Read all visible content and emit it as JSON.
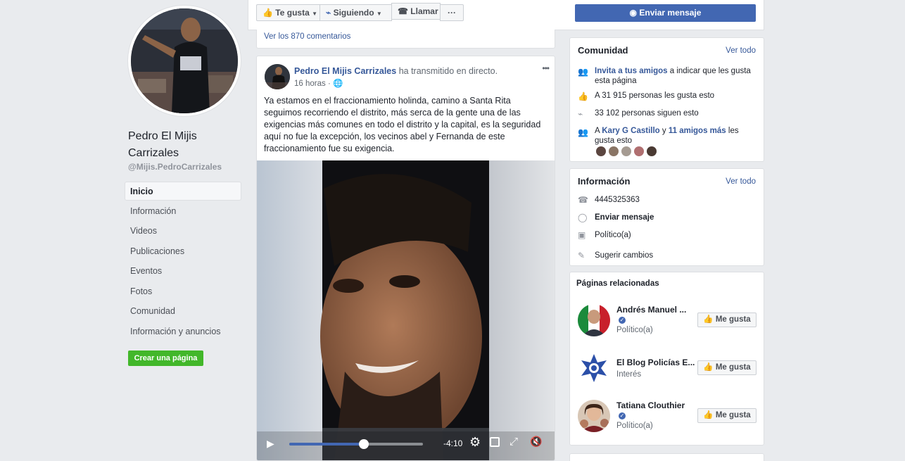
{
  "profile": {
    "name": "Pedro El Mijis Carrizales",
    "handle": "@Mijis.PedroCarrizales"
  },
  "nav": [
    {
      "label": "Inicio",
      "active": true
    },
    {
      "label": "Información"
    },
    {
      "label": "Videos"
    },
    {
      "label": "Publicaciones"
    },
    {
      "label": "Eventos"
    },
    {
      "label": "Fotos"
    },
    {
      "label": "Comunidad"
    },
    {
      "label": "Información y anuncios"
    }
  ],
  "create_page_label": "Crear una página",
  "action_bar": {
    "like_label": "Te gusta",
    "following_label": "Siguiendo",
    "call_label": "Llamar",
    "more_label": "···",
    "send_message_label": "Enviar mensaje"
  },
  "prev_post": {
    "comments_link": "Ver los 870 comentarios"
  },
  "post": {
    "author": "Pedro El Mijis Carrizales",
    "action": "ha transmitido en directo.",
    "time": "16 horas",
    "separator": "·",
    "more": "•••",
    "text": "Ya estamos en el fraccionamiento holinda, camino a Santa Rita seguimos recorriendo el distrito, más serca de la gente una de las exigencias más comunes en todo el distrito y la capital, es la seguridad aquí no fue la excepción, los vecinos abel y Fernanda de este fraccionamiento fue su exigencia.",
    "video": {
      "time_remaining": "-4:10",
      "progress": 0.56
    }
  },
  "community": {
    "title": "Comunidad",
    "see_all": "Ver todo",
    "invite_link": "Invita a tus amigos",
    "invite_rest": "a indicar que les gusta esta página",
    "likes": "A 31 915 personas les gusta esto",
    "followers": "33 102 personas siguen esto",
    "friends_prefix": "A",
    "friend_name": "Kary G Castillo",
    "friends_and": "y",
    "friends_more": "11 amigos más",
    "friends_suffix": "les gusta esto"
  },
  "info": {
    "title": "Información",
    "see_all": "Ver todo",
    "phone": "4445325363",
    "message": "Enviar mensaje",
    "category": "Político(a)",
    "suggest": "Sugerir cambios"
  },
  "related": {
    "title": "Páginas relacionadas",
    "like_label": "Me gusta",
    "pages": [
      {
        "name": "Andrés Manuel ...",
        "category": "Político(a)",
        "verified": true
      },
      {
        "name": "El Blog Policías E...",
        "category": "Interés",
        "verified": false
      },
      {
        "name": "Tatiana Clouthier",
        "category": "Político(a)",
        "verified": true
      }
    ]
  },
  "colors": {
    "brand": "#4267b2",
    "link": "#365899",
    "green": "#42b72a"
  }
}
